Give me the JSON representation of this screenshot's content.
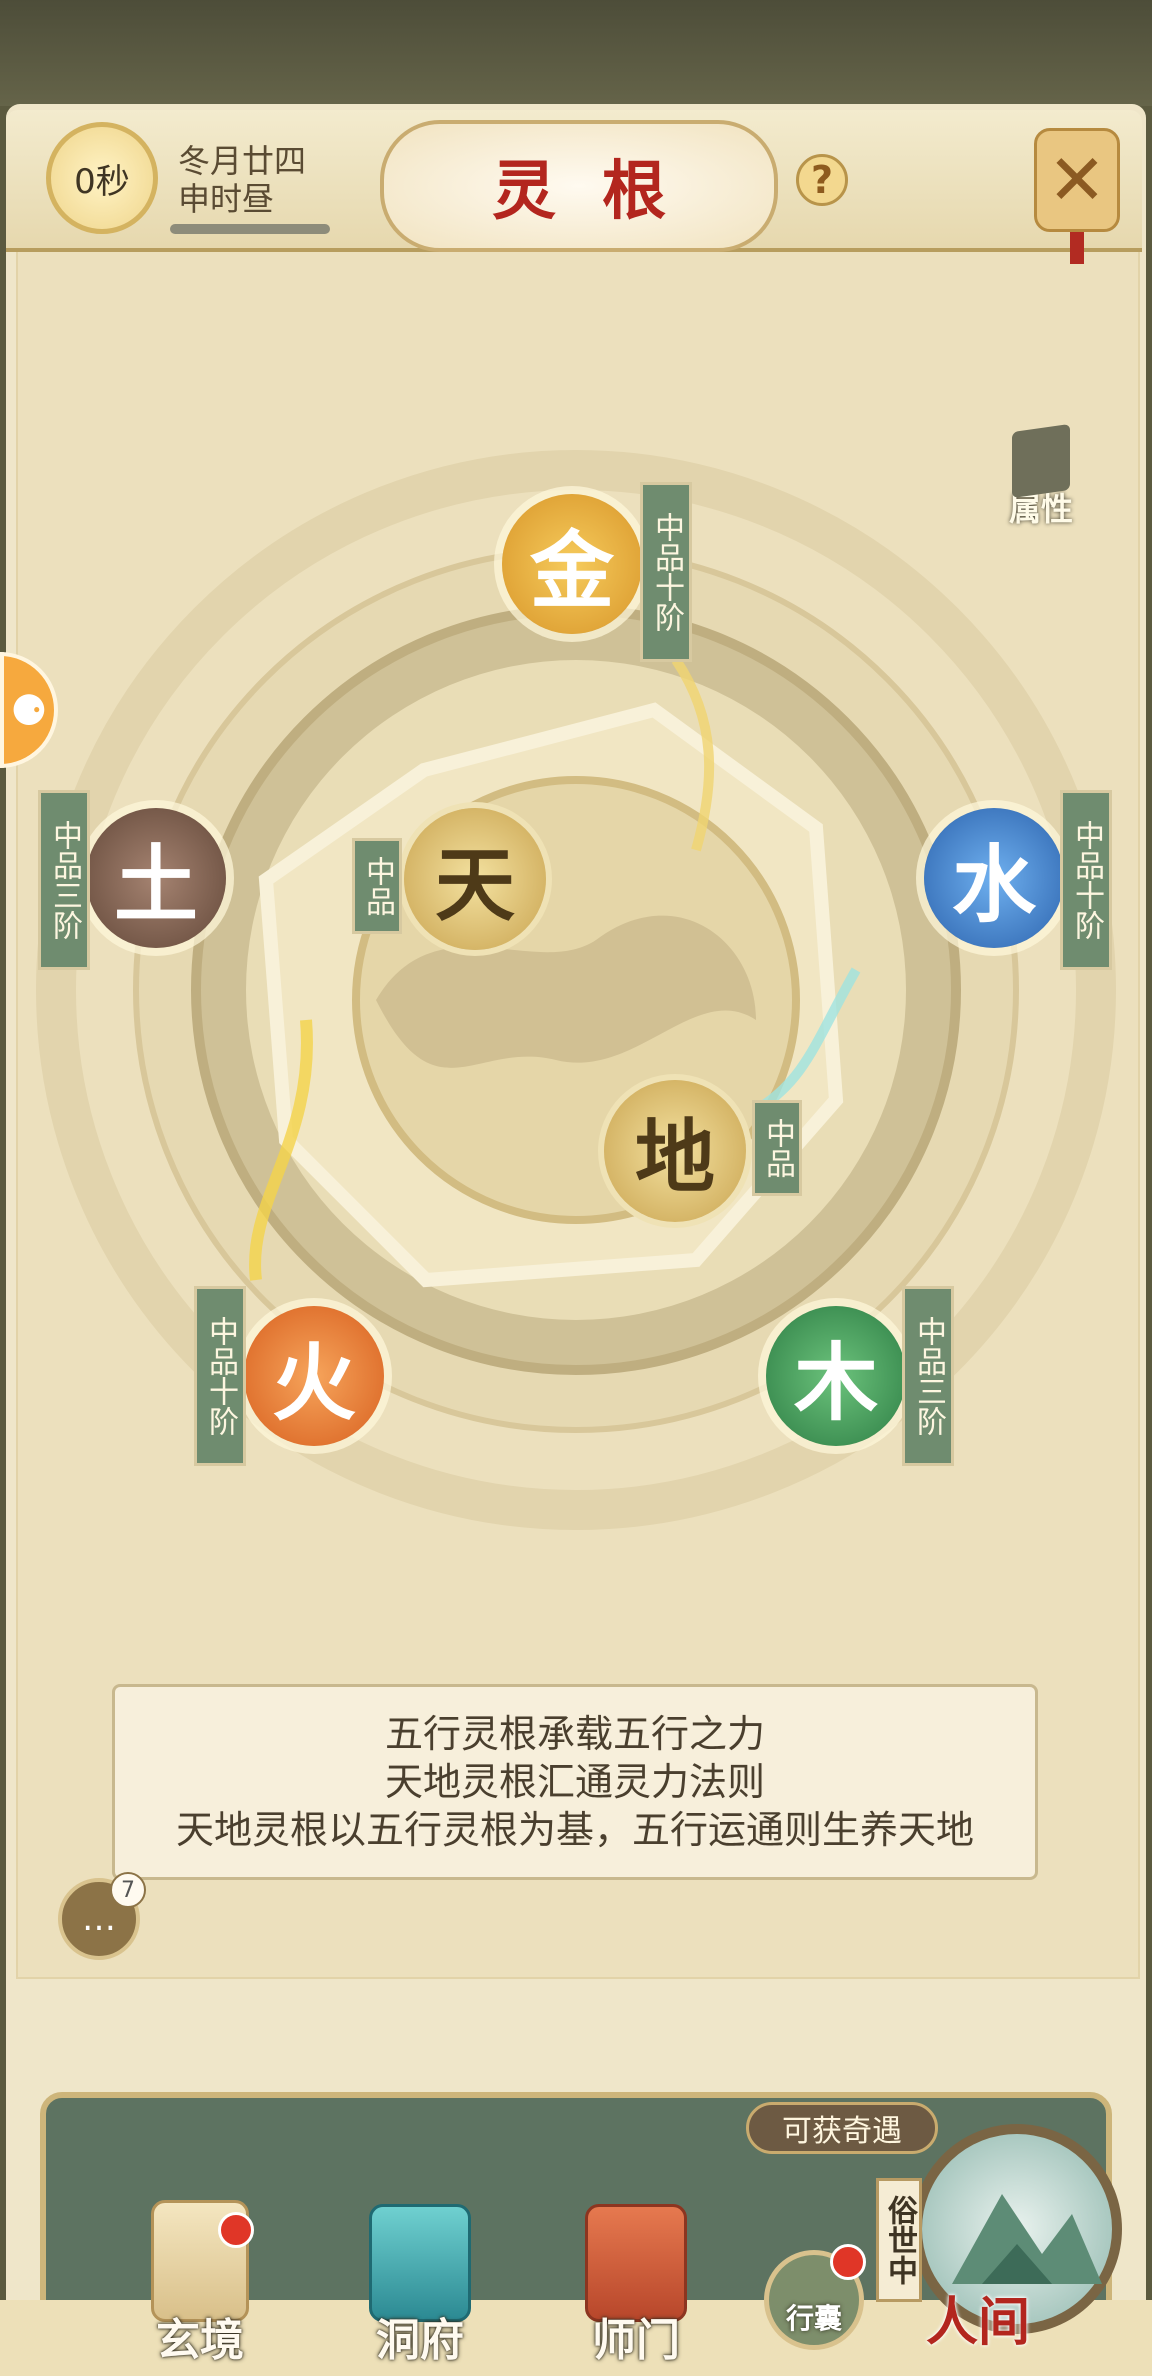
{
  "header": {
    "timer": "0秒",
    "date_line1": "冬月廿四",
    "date_line2": "申时昼",
    "title": "灵根",
    "help_icon": "?"
  },
  "attribute_button": {
    "label": "属性"
  },
  "elements": {
    "gold": {
      "glyph": "金",
      "tag": "中品十阶",
      "color": "#e5ad3c"
    },
    "water": {
      "glyph": "水",
      "tag": "中品十阶",
      "color": "#3f7fc6"
    },
    "wood": {
      "glyph": "木",
      "tag": "中品三阶",
      "color": "#3f9a58"
    },
    "fire": {
      "glyph": "火",
      "tag": "中品十阶",
      "color": "#e8792e"
    },
    "earth": {
      "glyph": "土",
      "tag": "中品三阶",
      "color": "#7a5f4e"
    },
    "heaven": {
      "glyph": "天",
      "tag": "中品",
      "color": "#d9b866"
    },
    "ground": {
      "glyph": "地",
      "tag": "中品",
      "color": "#d9b866"
    }
  },
  "description": [
    "五行灵根承载五行之力",
    "天地灵根汇通灵力法则",
    "天地灵根以五行灵根为基，五行运通则生养天地"
  ],
  "chat": {
    "badge_count": "7"
  },
  "bottom_nav": {
    "event_button": "可获奇遇",
    "items": [
      {
        "label": "玄境",
        "icon": "scroll-icon"
      },
      {
        "label": "洞府",
        "icon": "pavilion-icon"
      },
      {
        "label": "师门",
        "icon": "banner-icon"
      }
    ],
    "bag_label": "行囊",
    "world_tag": "俗世中",
    "world_label": "人间"
  }
}
